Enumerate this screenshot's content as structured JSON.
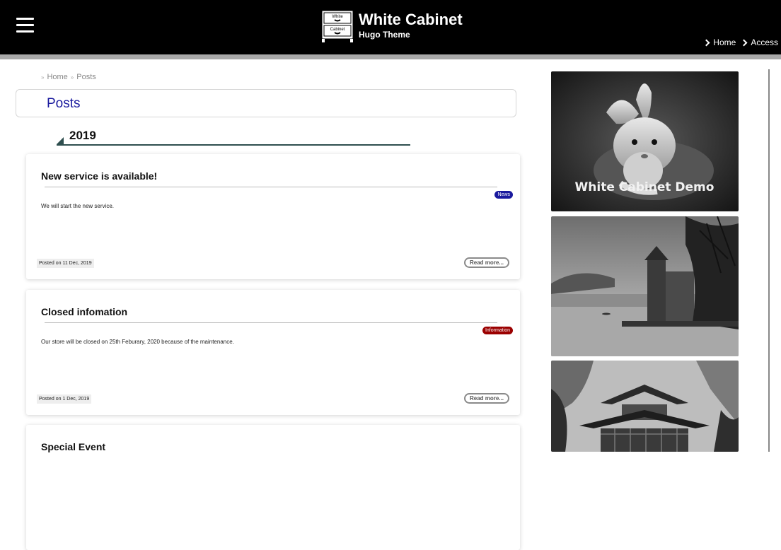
{
  "header": {
    "site_title": "White Cabinet",
    "site_subtitle": "Hugo Theme",
    "logo_top_label": "White",
    "logo_bottom_label": "Cabinet",
    "nav": [
      {
        "label": "Home"
      },
      {
        "label": "Access"
      }
    ]
  },
  "breadcrumb": {
    "home": "Home",
    "current": "Posts"
  },
  "page_title": "Posts",
  "year_heading": "2019",
  "posts": [
    {
      "title": "New service is available!",
      "tag": "News",
      "tag_color": "#1a1a9e",
      "excerpt": "We will start the new service.",
      "posted": "Posted on 11 Dec, 2019",
      "read_more": "Read more..."
    },
    {
      "title": "Closed infomation",
      "tag": "Information",
      "tag_color": "#9b0000",
      "excerpt": "Our store will be closed on 25th Feburary, 2020 because of the maintenance.",
      "posted": "Posted on 1 Dec, 2019",
      "read_more": "Read more..."
    },
    {
      "title": "Special Event"
    }
  ],
  "sidebar": {
    "banner_text": "White Cabinet Demo"
  }
}
